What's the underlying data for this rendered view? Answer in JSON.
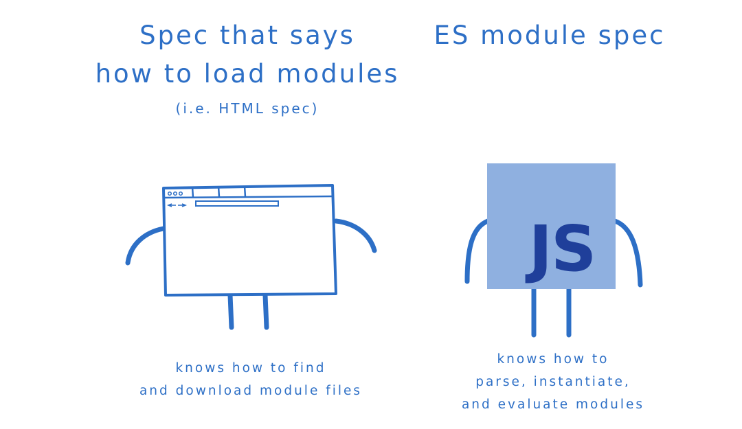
{
  "colors": {
    "ink": "#2d6fc6",
    "js_box": "#8fb0e0",
    "js_text": "#1f3f9a",
    "background": "#ffffff"
  },
  "left": {
    "title_line1": "Spec that says",
    "title_line2": "how to load modules",
    "subtitle": "(i.e. HTML spec)",
    "caption_line1": "knows how to find",
    "caption_line2": "and download module files",
    "icon": "browser-window-icon"
  },
  "right": {
    "title": "ES module spec",
    "logo_text": "JS",
    "caption_line1": "knows how to",
    "caption_line2": "parse, instantiate,",
    "caption_line3": "and evaluate modules",
    "icon": "js-logo-icon"
  }
}
